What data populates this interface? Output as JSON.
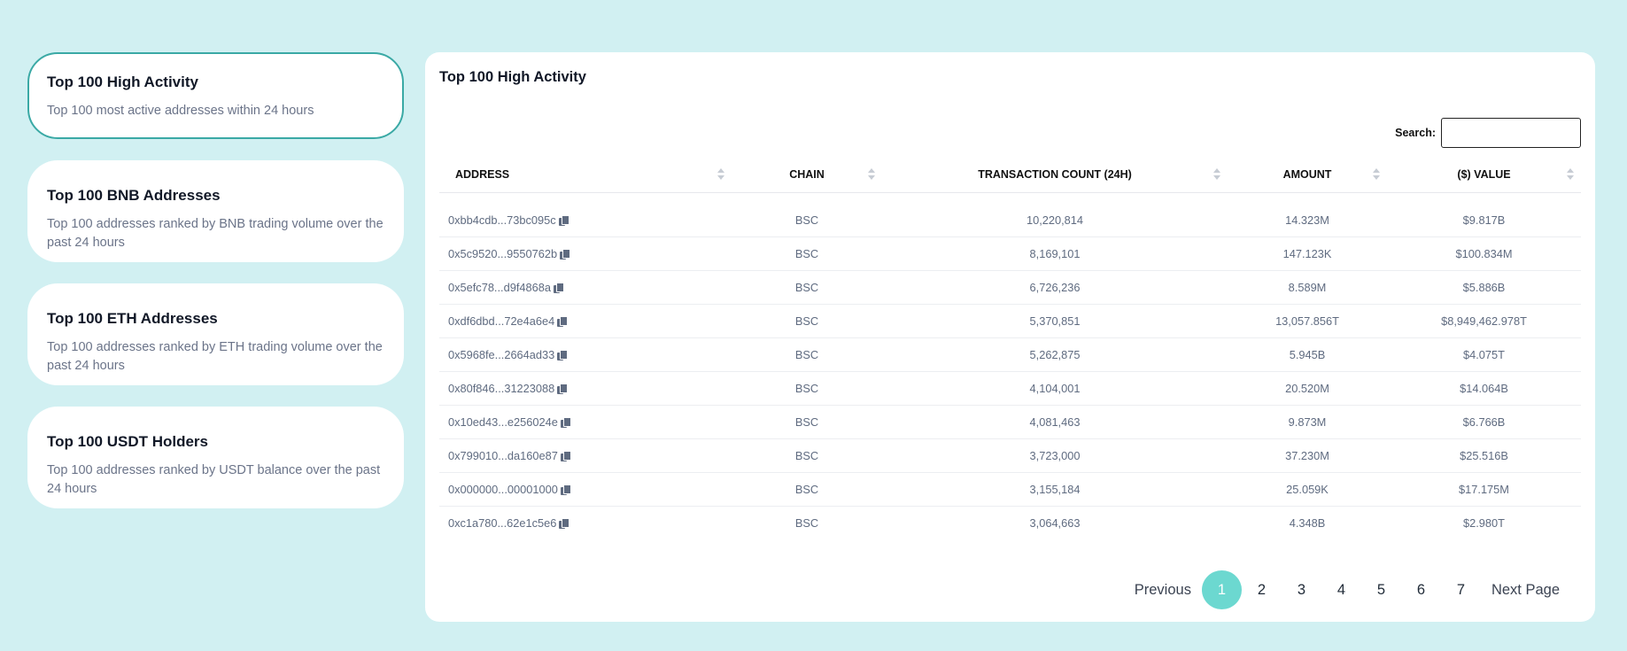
{
  "sidebar": {
    "cards": [
      {
        "title": "Top 100 High Activity",
        "desc": "Top 100 most active addresses within 24 hours"
      },
      {
        "title": "Top 100 BNB Addresses",
        "desc": "Top 100 addresses ranked by BNB trading volume over the past 24 hours"
      },
      {
        "title": "Top 100 ETH Addresses",
        "desc": "Top 100 addresses ranked by ETH trading volume over the past 24 hours"
      },
      {
        "title": "Top 100 USDT Holders",
        "desc": "Top 100 addresses ranked by USDT balance over the past 24 hours"
      }
    ]
  },
  "panel": {
    "title": "Top 100 High Activity",
    "search": {
      "label": "Search:",
      "value": "",
      "placeholder": ""
    },
    "columns": [
      "ADDRESS",
      "CHAIN",
      "TRANSACTION COUNT (24H)",
      "AMOUNT",
      "($) VALUE"
    ],
    "rows": [
      {
        "address": "0xbb4cdb...73bc095c",
        "chain": "BSC",
        "count": "10,220,814",
        "amount": "14.323M",
        "value": "$9.817B"
      },
      {
        "address": "0x5c9520...9550762b",
        "chain": "BSC",
        "count": "8,169,101",
        "amount": "147.123K",
        "value": "$100.834M"
      },
      {
        "address": "0x5efc78...d9f4868a",
        "chain": "BSC",
        "count": "6,726,236",
        "amount": "8.589M",
        "value": "$5.886B"
      },
      {
        "address": "0xdf6dbd...72e4a6e4",
        "chain": "BSC",
        "count": "5,370,851",
        "amount": "13,057.856T",
        "value": "$8,949,462.978T"
      },
      {
        "address": "0x5968fe...2664ad33",
        "chain": "BSC",
        "count": "5,262,875",
        "amount": "5.945B",
        "value": "$4.075T"
      },
      {
        "address": "0x80f846...31223088",
        "chain": "BSC",
        "count": "4,104,001",
        "amount": "20.520M",
        "value": "$14.064B"
      },
      {
        "address": "0x10ed43...e256024e",
        "chain": "BSC",
        "count": "4,081,463",
        "amount": "9.873M",
        "value": "$6.766B"
      },
      {
        "address": "0x799010...da160e87",
        "chain": "BSC",
        "count": "3,723,000",
        "amount": "37.230M",
        "value": "$25.516B"
      },
      {
        "address": "0x000000...00001000",
        "chain": "BSC",
        "count": "3,155,184",
        "amount": "25.059K",
        "value": "$17.175M"
      },
      {
        "address": "0xc1a780...62e1c5e6",
        "chain": "BSC",
        "count": "3,064,663",
        "amount": "4.348B",
        "value": "$2.980T"
      }
    ],
    "pagination": {
      "previous": "Previous",
      "pages": [
        "1",
        "2",
        "3",
        "4",
        "5",
        "6",
        "7"
      ],
      "current": "1",
      "next": "Next Page"
    }
  },
  "colors": {
    "background": "#d1f0f2",
    "accent": "#6cd8d0",
    "active_border": "#3aa9a5"
  },
  "icons": {
    "copy": "copy-icon",
    "sort": "sort-icon"
  }
}
